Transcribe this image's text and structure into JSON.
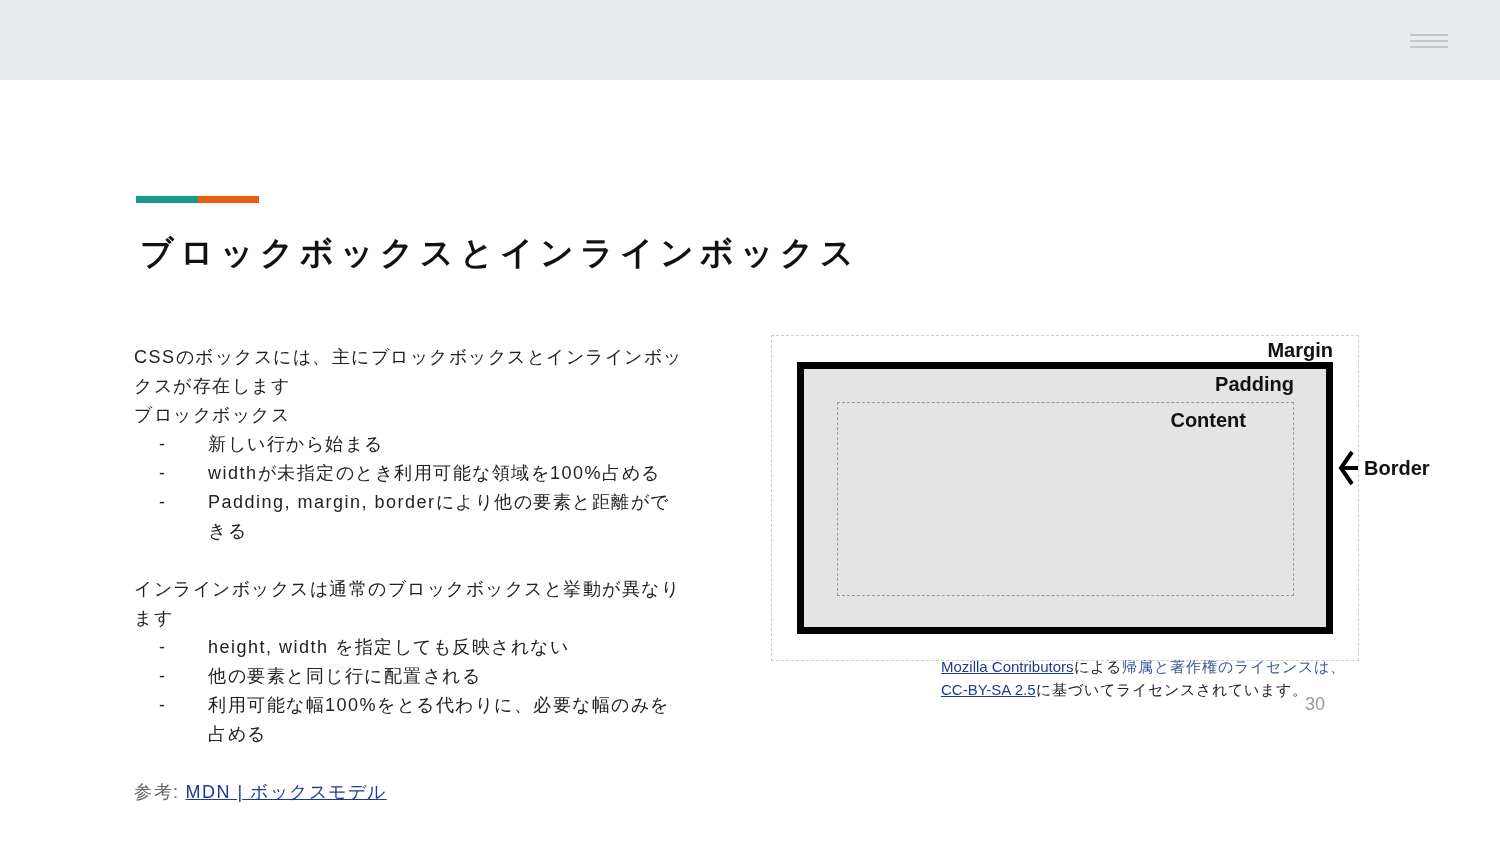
{
  "slide": {
    "title": "ブロックボックスとインラインボックス",
    "sections": [
      {
        "lines": [
          "CSSのボックスには、主にブロックボックスとインラインボックスが存在します",
          "ブロックボックス"
        ],
        "bullets": [
          {
            "marker": "-",
            "text": "新しい行から始まる"
          },
          {
            "marker": "-",
            "text": "widthが未指定のとき利用可能な領域を100%占める"
          },
          {
            "marker": "-",
            "text": "Padding, margin, borderにより他の要素と距離ができる"
          }
        ]
      },
      {
        "lines": [
          "インラインボックスは通常のブロックボックスと挙動が異なります"
        ],
        "bullets": [
          {
            "marker": "-",
            "text": "height, width を指定しても反映されない"
          },
          {
            "marker": "-",
            "text": "他の要素と同じ行に配置される"
          },
          {
            "marker": "-",
            "text": "利用可能な幅100%をとる代わりに、必要な幅のみを占める"
          }
        ]
      }
    ],
    "reference": {
      "label": "参考:",
      "link": "MDN | ボックスモデル"
    },
    "diagram": {
      "margin_label": "Margin",
      "padding_label": "Padding",
      "content_label": "Content",
      "border_label": "Border"
    },
    "caption": [
      {
        "kind": "link",
        "text": "Mozilla Contributors"
      },
      {
        "kind": "plain",
        "text": "による"
      },
      {
        "kind": "accent",
        "text": "帰属と著作権のライセンスは、"
      },
      {
        "kind": "link",
        "text": "CC-BY-SA 2.5"
      },
      {
        "kind": "plain",
        "text": "に基づいてライセンスされています。"
      }
    ],
    "page_number": "30"
  }
}
